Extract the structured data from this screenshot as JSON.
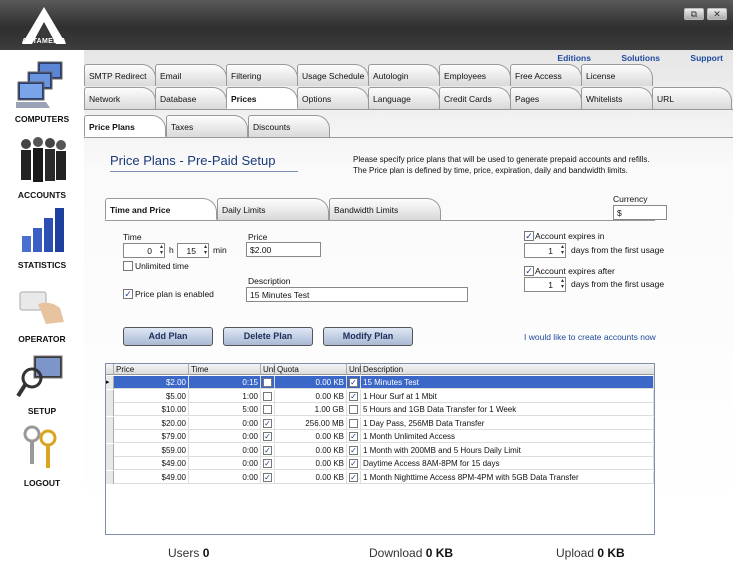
{
  "window": {
    "logo_text": "ANTAMEDIA",
    "buttons": [
      "⧉",
      "✕"
    ]
  },
  "sidebar": {
    "items": [
      {
        "label": "COMPUTERS",
        "icon": "computers-icon"
      },
      {
        "label": "ACCOUNTS",
        "icon": "accounts-icon"
      },
      {
        "label": "STATISTICS",
        "icon": "statistics-icon"
      },
      {
        "label": "OPERATOR",
        "icon": "operator-icon"
      },
      {
        "label": "SETUP",
        "icon": "setup-icon"
      },
      {
        "label": "LOGOUT",
        "icon": "logout-icon"
      }
    ]
  },
  "toplinks": [
    "Editions",
    "Solutions",
    "Support"
  ],
  "tabs_row1": [
    "SMTP Redirect",
    "Email",
    "Filtering",
    "Usage Schedule",
    "Autologin",
    "Employees",
    "Free Access",
    "License"
  ],
  "tabs_row2": [
    "Network",
    "Database",
    "Prices",
    "Options",
    "Language",
    "Credit Cards",
    "Pages",
    "Whitelists",
    "URL"
  ],
  "subtabs": [
    "Price Plans",
    "Taxes",
    "Discounts"
  ],
  "panel": {
    "title": "Price Plans - Pre-Paid Setup",
    "desc": "Please specify price plans that will be used to generate prepaid accounts and refills. The Price plan is defined by time, price, expiration, daily and bandwidth limits.",
    "currency_label": "Currency",
    "currency_value": "$",
    "inner_tabs": [
      "Time and Price",
      "Daily Limits",
      "Bandwidth Limits"
    ]
  },
  "form": {
    "time_label": "Time",
    "hours": "0",
    "h_unit": "h",
    "minutes": "15",
    "min_unit": "min",
    "unlimited_label": "Unlimited time",
    "enabled_label": "Price plan is enabled",
    "price_label": "Price",
    "price_value": "$2.00",
    "description_label": "Description",
    "description_value": "15 Minutes Test",
    "expire_label": "Account expires in",
    "expire_days": "1",
    "expire_suffix": "days from the first usage",
    "expire_after_label": "Account expires after",
    "expire_after_days": "1",
    "expire_after_suffix": "days from the first usage"
  },
  "buttons": {
    "add": "Add Plan",
    "delete": "Delete Plan",
    "modify": "Modify Plan",
    "create_link": "I would like to create accounts now"
  },
  "grid": {
    "headers": [
      "Price",
      "Time",
      "Unl",
      "Quota",
      "Unl",
      "Description"
    ],
    "rows": [
      {
        "price": "$2.00",
        "time": "0:15",
        "unl": false,
        "quota": "0.00 KB",
        "qunl": true,
        "desc": "15 Minutes Test"
      },
      {
        "price": "$5.00",
        "time": "1:00",
        "unl": false,
        "quota": "0.00 KB",
        "qunl": true,
        "desc": "1 Hour Surf at 1 Mbit"
      },
      {
        "price": "$10.00",
        "time": "5:00",
        "unl": false,
        "quota": "1.00 GB",
        "qunl": false,
        "desc": "5 Hours and 1GB Data Transfer for 1 Week"
      },
      {
        "price": "$20.00",
        "time": "0:00",
        "unl": true,
        "quota": "256.00 MB",
        "qunl": false,
        "desc": "1 Day Pass, 256MB Data Transfer"
      },
      {
        "price": "$79.00",
        "time": "0:00",
        "unl": true,
        "quota": "0.00 KB",
        "qunl": true,
        "desc": "1 Month Unlimited Access"
      },
      {
        "price": "$59.00",
        "time": "0:00",
        "unl": true,
        "quota": "0.00 KB",
        "qunl": true,
        "desc": "1 Month with 200MB and 5 Hours Daily Limit"
      },
      {
        "price": "$49.00",
        "time": "0:00",
        "unl": true,
        "quota": "0.00 KB",
        "qunl": true,
        "desc": "Daytime Access 8AM-8PM for 15 days"
      },
      {
        "price": "$49.00",
        "time": "0:00",
        "unl": true,
        "quota": "0.00 KB",
        "qunl": true,
        "desc": "1 Month Nighttime Access 8PM-4PM with 5GB Data Transfer"
      }
    ],
    "selected_index": 0
  },
  "status": {
    "users_label": "Users",
    "users_value": "0",
    "download_label": "Download",
    "download_value": "0 KB",
    "upload_label": "Upload",
    "upload_value": "0 KB"
  },
  "colors": {
    "selection": "#3a67c8",
    "link": "#1f4aa0"
  }
}
